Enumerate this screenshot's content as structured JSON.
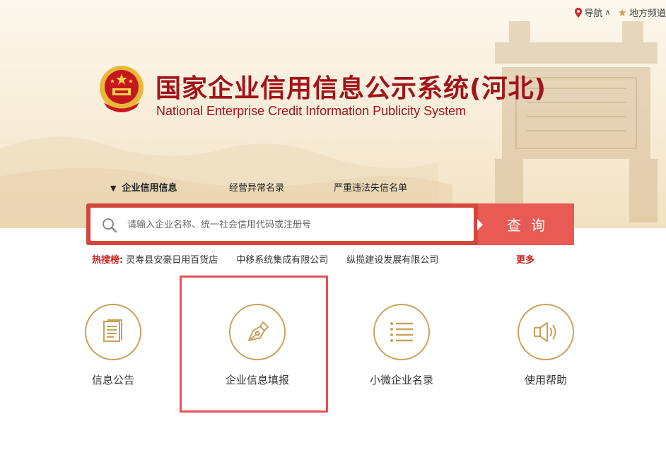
{
  "topnav": {
    "guide_label": "导航",
    "local_label": "地方频道"
  },
  "header": {
    "title_cn": "国家企业信用信息公示系统(河北)",
    "title_en": "National Enterprise Credit Information Publicity System"
  },
  "tabs": [
    {
      "label": "企业信用信息",
      "active": true
    },
    {
      "label": "经营异常名录",
      "active": false
    },
    {
      "label": "严重违法失信名单",
      "active": false
    }
  ],
  "search": {
    "placeholder": "请输入企业名称、统一社会信用代码或注册号",
    "button_label": "查询"
  },
  "hot": {
    "label": "热搜榜:",
    "items": [
      "灵寿县安豪日用百货店",
      "中移系统集成有限公司",
      "纵揽建设发展有限公司"
    ],
    "more_label": "更多"
  },
  "features": [
    {
      "label": "信息公告",
      "icon": "document-icon"
    },
    {
      "label": "企业信息填报",
      "icon": "pen-icon"
    },
    {
      "label": "小微企业名录",
      "icon": "list-icon"
    },
    {
      "label": "使用帮助",
      "icon": "speaker-icon"
    }
  ],
  "colors": {
    "brand_red": "#a0141a",
    "button_red": "#e85b55",
    "gold": "#c7a25a",
    "highlight": "#e65155"
  }
}
